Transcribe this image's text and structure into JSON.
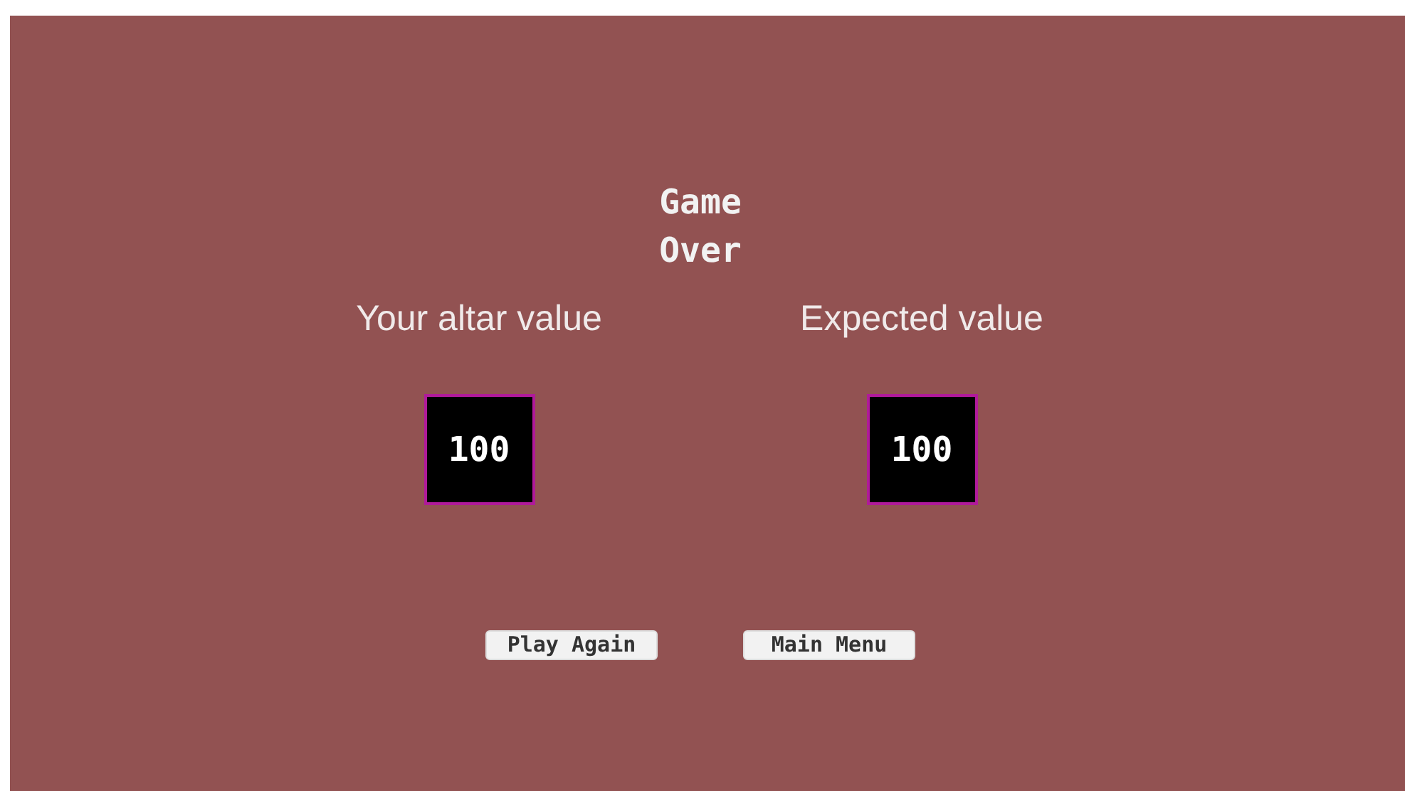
{
  "title": "Game Over",
  "scores": [
    {
      "label": "Your altar value",
      "value": "100"
    },
    {
      "label": "Expected value",
      "value": "100"
    }
  ],
  "buttons": [
    "Play Again",
    "Main Menu"
  ]
}
